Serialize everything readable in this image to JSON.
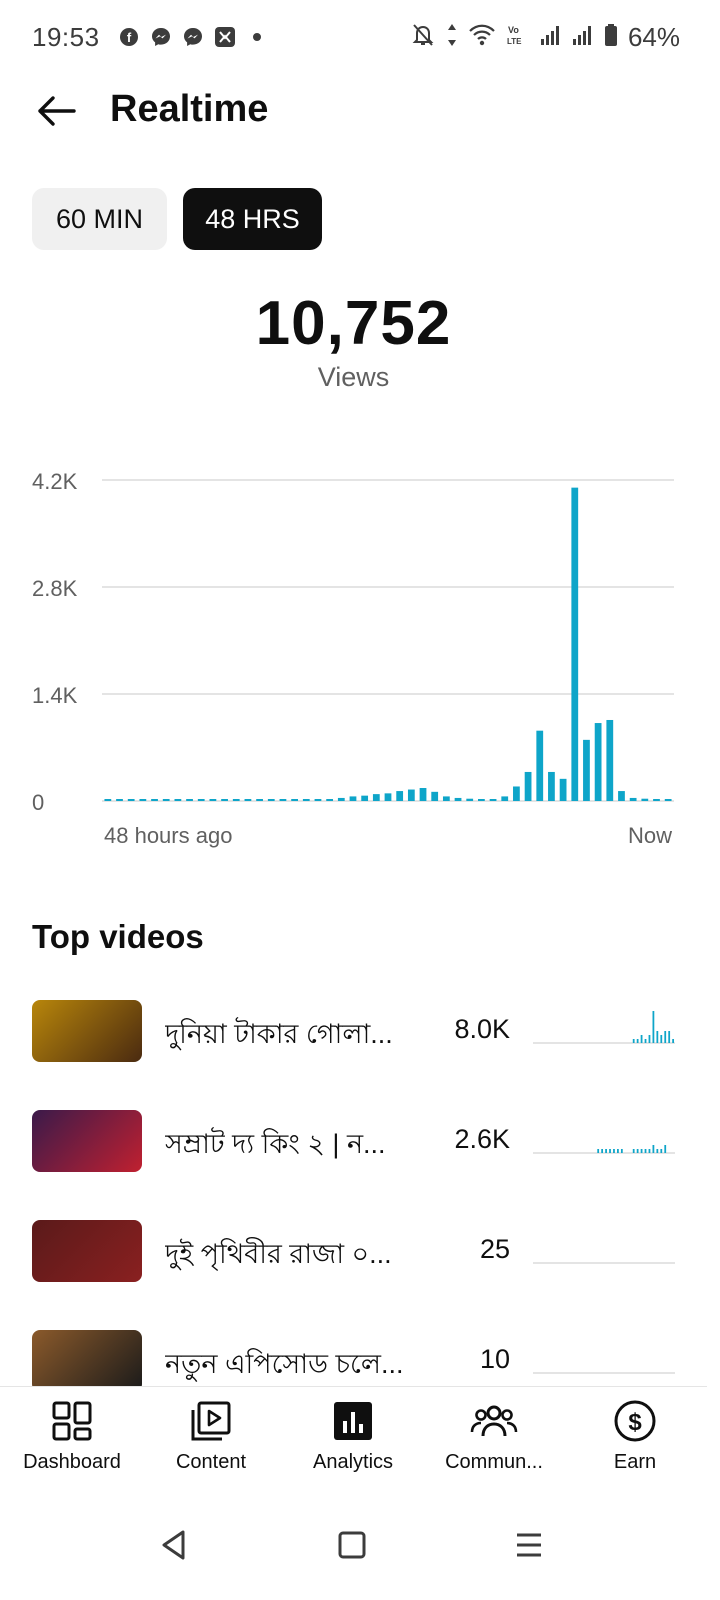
{
  "status_bar": {
    "time": "19:53",
    "left_icons": [
      "facebook-icon",
      "messenger-icon",
      "messenger-icon",
      "app-icon",
      "dot-icon"
    ],
    "right_icons": [
      "bell-off-icon",
      "data-arrows-icon",
      "wifi-icon",
      "volte-icon",
      "signal-icon",
      "signal-icon",
      "battery-icon"
    ],
    "battery": "64%"
  },
  "header": {
    "title": "Realtime"
  },
  "range_tabs": [
    {
      "label": "60 MIN",
      "selected": false
    },
    {
      "label": "48 HRS",
      "selected": true
    }
  ],
  "summary": {
    "count": "10,752",
    "label": "Views"
  },
  "chart_data": {
    "type": "bar",
    "y_ticks": [
      "4.2K",
      "2.8K",
      "1.4K",
      "0"
    ],
    "ylim": [
      0,
      4200
    ],
    "x_start_label": "48 hours ago",
    "x_end_label": "Now",
    "grid": true,
    "color": "#0ea5c9",
    "values": [
      0,
      0,
      0,
      0,
      0,
      0,
      0,
      0,
      0,
      0,
      0,
      0,
      0,
      0,
      0,
      0,
      0,
      0,
      0,
      0,
      40,
      60,
      70,
      90,
      100,
      130,
      150,
      170,
      120,
      60,
      40,
      30,
      25,
      20,
      60,
      190,
      380,
      920,
      380,
      290,
      4100,
      800,
      1020,
      1060,
      130,
      40,
      30,
      20,
      10
    ]
  },
  "top_videos": {
    "title": "Top videos",
    "items": [
      {
        "title": "দুনিয়া টাকার গোলা...",
        "views": "8.0K",
        "spark": [
          0,
          0,
          0,
          0,
          0,
          0,
          0,
          0,
          0,
          0,
          0,
          0,
          0,
          0,
          0,
          0,
          0,
          0,
          0,
          0,
          0,
          0,
          0,
          0,
          0,
          1,
          1,
          2,
          1,
          2,
          8,
          3,
          2,
          3,
          3,
          1
        ],
        "thumb": [
          "#b8860b",
          "#4a2a10"
        ]
      },
      {
        "title": "সম্রাট দ্য কিং ২ | ন...",
        "views": "2.6K",
        "spark": [
          0,
          0,
          0,
          0,
          0,
          0,
          0,
          0,
          0,
          0,
          0,
          0,
          0,
          0,
          0,
          0,
          1,
          1,
          1,
          1,
          1,
          1,
          1,
          0,
          0,
          1,
          1,
          1,
          1,
          1,
          2,
          1,
          1,
          2,
          0,
          0
        ],
        "thumb": [
          "#3a1a4a",
          "#c02030"
        ]
      },
      {
        "title": "দুই পৃথিবীর রাজা ০...",
        "views": "25",
        "spark": [
          0,
          0,
          0,
          0,
          0,
          0,
          0,
          0,
          0,
          0,
          0,
          0,
          0,
          0,
          0,
          0,
          0,
          0,
          0,
          0,
          0,
          0,
          0,
          0,
          0,
          0,
          0,
          0,
          0,
          0,
          0,
          0,
          0,
          0,
          0,
          0
        ],
        "thumb": [
          "#5a1a1a",
          "#8a2020"
        ]
      },
      {
        "title": "নতুন এপিসোড চলে...",
        "views": "10",
        "spark": [
          0,
          0,
          0,
          0,
          0,
          0,
          0,
          0,
          0,
          0,
          0,
          0,
          0,
          0,
          0,
          0,
          0,
          0,
          0,
          0,
          0,
          0,
          0,
          0,
          0,
          0,
          0,
          0,
          0,
          0,
          0,
          0,
          0,
          0,
          0,
          0
        ],
        "thumb": [
          "#8b5a2b",
          "#1a1a1a"
        ]
      }
    ]
  },
  "bottom_nav": [
    {
      "label": "Dashboard",
      "icon": "dashboard-icon",
      "active": false
    },
    {
      "label": "Content",
      "icon": "content-icon",
      "active": false
    },
    {
      "label": "Analytics",
      "icon": "analytics-icon",
      "active": true
    },
    {
      "label": "Commun...",
      "icon": "community-icon",
      "active": false
    },
    {
      "label": "Earn",
      "icon": "earn-icon",
      "active": false
    }
  ],
  "system_nav": [
    "back-triangle-icon",
    "home-square-icon",
    "menu-lines-icon"
  ]
}
